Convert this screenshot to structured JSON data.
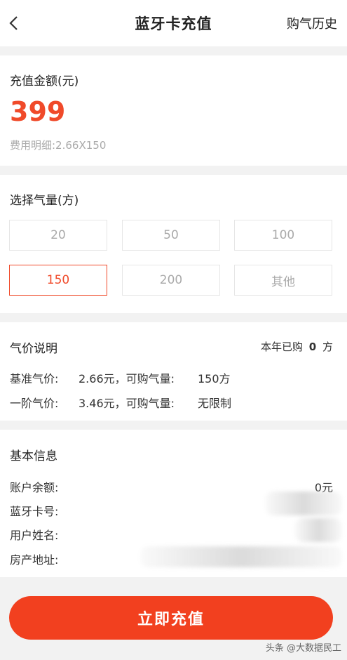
{
  "header": {
    "title": "蓝牙卡充值",
    "history_label": "购气历史"
  },
  "amount_card": {
    "label": "充值金额(元)",
    "amount": "399",
    "detail": "费用明细:2.66X150"
  },
  "volume_card": {
    "label": "选择气量(方)",
    "options": [
      "20",
      "50",
      "100",
      "150",
      "200",
      "其他"
    ],
    "selected": "150"
  },
  "price_card": {
    "label": "气价说明",
    "purchased_this_year": "本年已购",
    "purchased_value": "0",
    "purchased_unit": "方",
    "rows": [
      {
        "label": "基准气价:",
        "price": "2.66元，可购气量:",
        "limit": "150方"
      },
      {
        "label": "一阶气价:",
        "price": "3.46元，可购气量:",
        "limit": "无限制"
      }
    ]
  },
  "info_card": {
    "label": "基本信息",
    "rows": [
      {
        "label": "账户余额:",
        "value": "0元"
      },
      {
        "label": "蓝牙卡号:",
        "value": ""
      },
      {
        "label": "用户姓名:",
        "value": ""
      },
      {
        "label": "房产地址:",
        "value": ""
      }
    ]
  },
  "cta_label": "立即充值",
  "watermark": "头条 @大数据民工",
  "colors": {
    "accent": "#f04a2a",
    "button": "#f2401f"
  }
}
